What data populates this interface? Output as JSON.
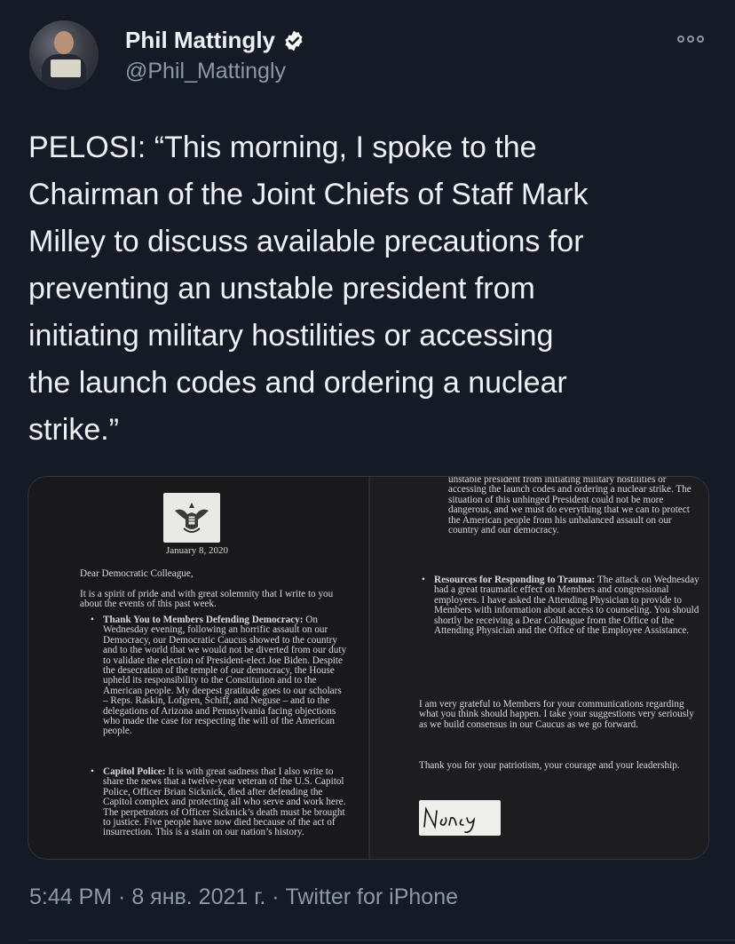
{
  "author": {
    "name": "Phil Mattingly",
    "handle": "@Phil_Mattingly"
  },
  "tweet": {
    "text": "PELOSI: “This morning, I spoke to the\nChairman of the Joint Chiefs of Staff Mark\nMilley to discuss available precautions for\npreventing an unstable president from\ninitiating military hostilities or accessing\nthe launch codes and ordering a nuclear\nstrike.”"
  },
  "letter": {
    "date": "January 8, 2020",
    "greeting": "Dear Democratic Colleague,",
    "intro": "It is a spirit of pride and with great solemnity that I write to you about the events of this past week.",
    "item1_title": "Thank You to Members Defending Democracy:",
    "item1_body": "On Wednesday evening, following an horrific assault on our Democracy, our Democratic Caucus showed to the country and to the world that we would not be diverted from our duty to validate the election of President-elect Joe Biden. Despite the desecration of the temple of our democracy, the House upheld its responsibility to the Constitution and to the American people. My deepest gratitude goes to our scholars – Reps. Raskin, Lofgren, Schiff, and Neguse – and to the delegations of Arizona and Pennsylvania facing objections who made the case for respecting the will of the American people.",
    "item2_title": "Capitol Police:",
    "item2_body": "It is with great sadness that I also write to share the news that a twelve-year veteran of the U.S. Capitol Police, Officer Brian Sicknick, died after defending the Capitol complex and protecting all who serve and work here. The perpetrators of Officer Sicknick’s death must be brought to justice. Five people have now died because of the act of insurrection. This is a stain on our nation’s history.",
    "right_top": "unstable president from initiating military hostilities or accessing the launch codes and ordering a nuclear strike. The situation of this unhinged President could not be more dangerous, and we must do everything that we can to protect the American people from his unbalanced assault on our country and our democracy.",
    "item3_title": "Resources for Responding to Trauma:",
    "item3_body": "The attack on Wednesday had a great traumatic effect on Members and congressional employees. I have asked the Attending Physician to provide to Members with information about access to counseling. You should shortly be receiving a Dear Colleague from the Office of the Attending Physician and the Office of the Employee Assistance.",
    "closing1": "I am very grateful to Members for your communications regarding what you think should happen. I take your suggestions very seriously as we build consensus in our Caucus as we go forward.",
    "closing2": "Thank you for your patriotism, your courage and your leadership.",
    "signature": "Nancy"
  },
  "footer": {
    "meta": "5:44 PM · 8 янв. 2021 г. · Twitter for iPhone"
  },
  "colors": {
    "background": "#151b26",
    "verified_badge": "#ffffff",
    "secondary_text": "#8b98a5"
  },
  "icons": {
    "verified": "verified-badge-icon",
    "more": "more-options-icon",
    "seal": "great-seal-icon"
  }
}
